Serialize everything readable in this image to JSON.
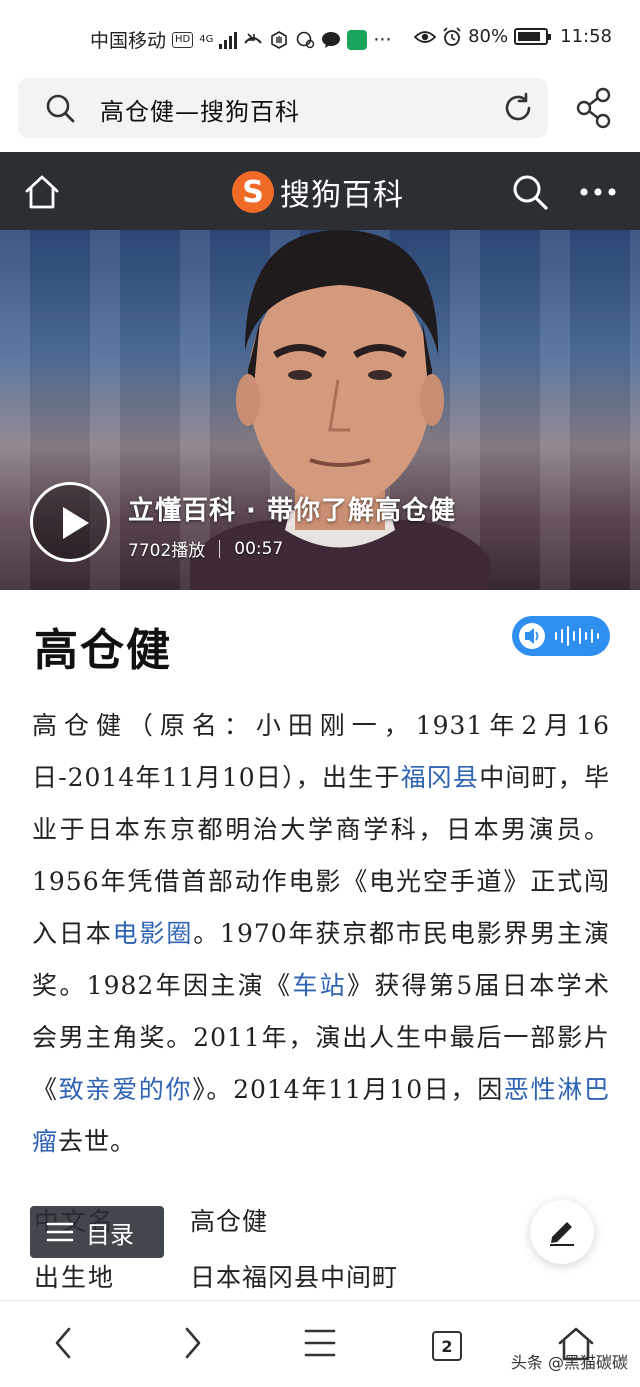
{
  "status_bar": {
    "carrier": "中国移动",
    "hd_badge": "HD",
    "network": "4G",
    "battery": "80%",
    "battery_level": 0.8,
    "time": "11:58",
    "more": "···"
  },
  "url_bar": {
    "title": "高仓健—搜狗百科",
    "icons": [
      "search-icon",
      "refresh-icon",
      "share-icon"
    ]
  },
  "site_header": {
    "logo_mark": "S",
    "logo_text": "搜狗百科",
    "icons": [
      "home-icon",
      "search-icon",
      "more-icon"
    ]
  },
  "video": {
    "title": "立懂百科 · 带你了解高仓健",
    "plays": "7702播放",
    "duration": "00:57"
  },
  "entry": {
    "title": "高仓健",
    "summary": [
      {
        "t": "高仓健（原名：小田刚一，1931年2月16日-2014年11月10日），出生于"
      },
      {
        "t": "福冈县",
        "link": true
      },
      {
        "t": "中间町，毕业于日本东京都明治大学商学科，日本男演员。 1956年凭借首部动作电影《电光空手道》正式闯入日本"
      },
      {
        "t": "电影圈",
        "link": true
      },
      {
        "t": "。1970年获京都市民电影界男主演奖。1982年因主演《"
      },
      {
        "t": "车站",
        "link": true
      },
      {
        "t": "》获得第5届日本学术会男主角奖。2011年，演出人生中最后一部影片《"
      },
      {
        "t": "致亲爱的你",
        "link": true
      },
      {
        "t": "》。2014年11月10日，因"
      },
      {
        "t": "恶性淋巴瘤",
        "link": true
      },
      {
        "t": "去世。"
      }
    ],
    "info": [
      {
        "key": "中文名",
        "value": "高仓健"
      },
      {
        "key": "出生地",
        "value": "日本福冈县中间町"
      }
    ]
  },
  "floating": {
    "toc_label": "目录"
  },
  "bottom_nav": {
    "tab_count": "2",
    "watermark": "头条 @黑猫碳碳"
  }
}
